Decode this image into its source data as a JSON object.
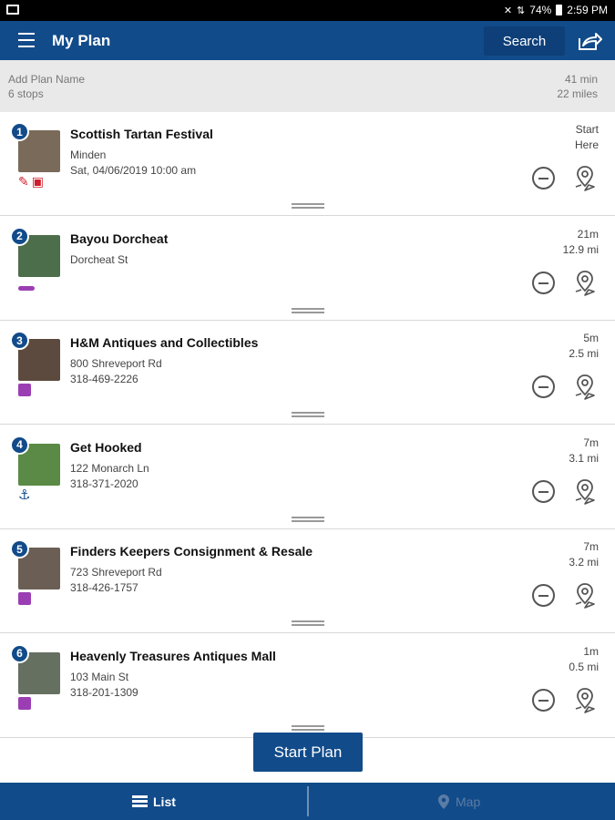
{
  "status": {
    "battery": "74%",
    "time": "2:59 PM"
  },
  "appbar": {
    "title": "My Plan",
    "search_label": "Search"
  },
  "summary": {
    "plan_name_placeholder": "Add Plan Name",
    "stops": "6 stops",
    "time": "41 min",
    "distance": "22 miles"
  },
  "stops": [
    {
      "num": "1",
      "title": "Scottish Tartan Festival",
      "line1": "Minden",
      "line2": "Sat, 04/06/2019 10:00 am",
      "eta1": "Start",
      "eta2": "Here",
      "thumb_color": "#7a6a5a",
      "category": "event"
    },
    {
      "num": "2",
      "title": "Bayou Dorcheat",
      "line1": "Dorcheat St",
      "line2": "",
      "eta1": "21m",
      "eta2": "12.9 mi",
      "thumb_color": "#4c6e4a",
      "category": "kayak"
    },
    {
      "num": "3",
      "title": "H&M Antiques and Collectibles",
      "line1": "800 Shreveport Rd",
      "line2": "318-469-2226",
      "eta1": "5m",
      "eta2": "2.5 mi",
      "thumb_color": "#5c4a3e",
      "category": "shopping"
    },
    {
      "num": "4",
      "title": "Get Hooked",
      "line1": "122 Monarch Ln",
      "line2": "318-371-2020",
      "eta1": "7m",
      "eta2": "3.1 mi",
      "thumb_color": "#5a8a45",
      "category": "fishing"
    },
    {
      "num": "5",
      "title": "Finders Keepers Consignment & Resale",
      "line1": "723 Shreveport Rd",
      "line2": "318-426-1757",
      "eta1": "7m",
      "eta2": "3.2 mi",
      "thumb_color": "#6b5f55",
      "category": "shopping"
    },
    {
      "num": "6",
      "title": "Heavenly Treasures Antiques Mall",
      "line1": "103 Main St",
      "line2": "318-201-1309",
      "eta1": "1m",
      "eta2": "0.5 mi",
      "thumb_color": "#657060",
      "category": "shopping"
    }
  ],
  "start_plan_label": "Start Plan",
  "bottom_nav": {
    "list_label": "List",
    "map_label": "Map"
  }
}
